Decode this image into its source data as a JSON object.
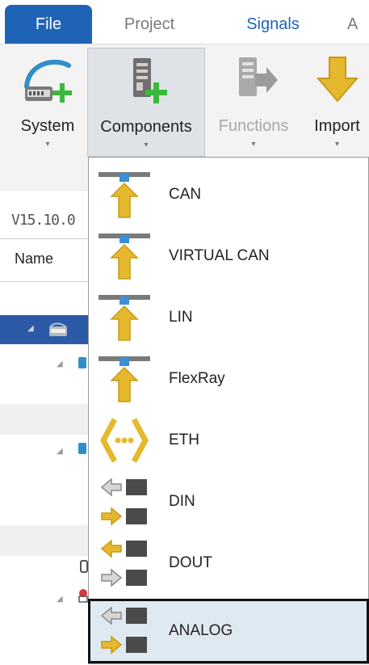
{
  "tabs": [
    {
      "label": "File"
    },
    {
      "label": "Project"
    },
    {
      "label": "Signals"
    },
    {
      "label": "A"
    }
  ],
  "ribbon": {
    "system": {
      "label": "System",
      "arrow": "▾"
    },
    "components": {
      "label": "Components",
      "arrow": "▾"
    },
    "functions": {
      "label": "Functions",
      "arrow": "▾"
    },
    "import": {
      "label": "Import",
      "arrow": "▾"
    }
  },
  "panel": {
    "version": "V15.10.0",
    "name_header": "Name"
  },
  "dropdown": {
    "items": [
      {
        "label": "CAN",
        "icon": "bus-connector-icon"
      },
      {
        "label": "VIRTUAL CAN",
        "icon": "bus-connector-icon"
      },
      {
        "label": "LIN",
        "icon": "bus-connector-icon"
      },
      {
        "label": "FlexRay",
        "icon": "bus-connector-icon"
      },
      {
        "label": "ETH",
        "icon": "ethernet-icon"
      },
      {
        "label": "DIN",
        "icon": "digital-input-icon"
      },
      {
        "label": "DOUT",
        "icon": "digital-output-icon"
      },
      {
        "label": "ANALOG",
        "icon": "analog-icon",
        "selected": true
      }
    ]
  },
  "colors": {
    "accent": "#1f63b7",
    "selection_row": "#2d5aa7",
    "gold": "#e6b82e",
    "green_plus": "#3db83d"
  }
}
